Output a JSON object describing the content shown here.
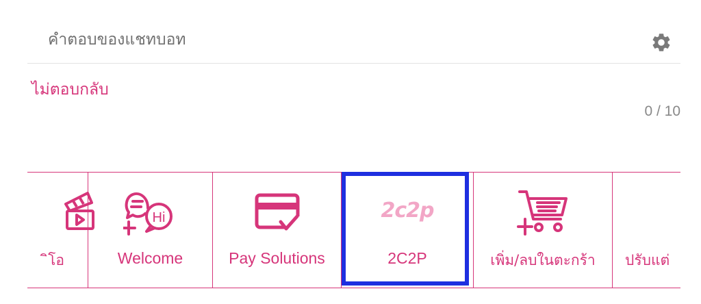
{
  "header": {
    "title": "คำตอบของแชทบอท",
    "settings_icon": "gear-icon"
  },
  "reply": {
    "label": "ไม่ตอบกลับ",
    "counter": "0 / 10"
  },
  "tiles": [
    {
      "label": "ิโอ",
      "icon": "video-clapper-icon"
    },
    {
      "label": "Welcome",
      "icon": "greeting-hi-icon"
    },
    {
      "label": "Pay Solutions",
      "icon": "card-check-icon"
    },
    {
      "label": "2C2P",
      "logo_text": "2c2p",
      "icon": "2c2p-logo"
    },
    {
      "label": "เพิ่ม/ลบในตะกร้า",
      "icon": "cart-add-icon"
    },
    {
      "label": "ปรับแต่",
      "icon": ""
    }
  ],
  "colors": {
    "accent": "#d6357a",
    "logo": "#f2a6c6",
    "selection": "#1e2fe0",
    "muted_text": "#707070"
  }
}
